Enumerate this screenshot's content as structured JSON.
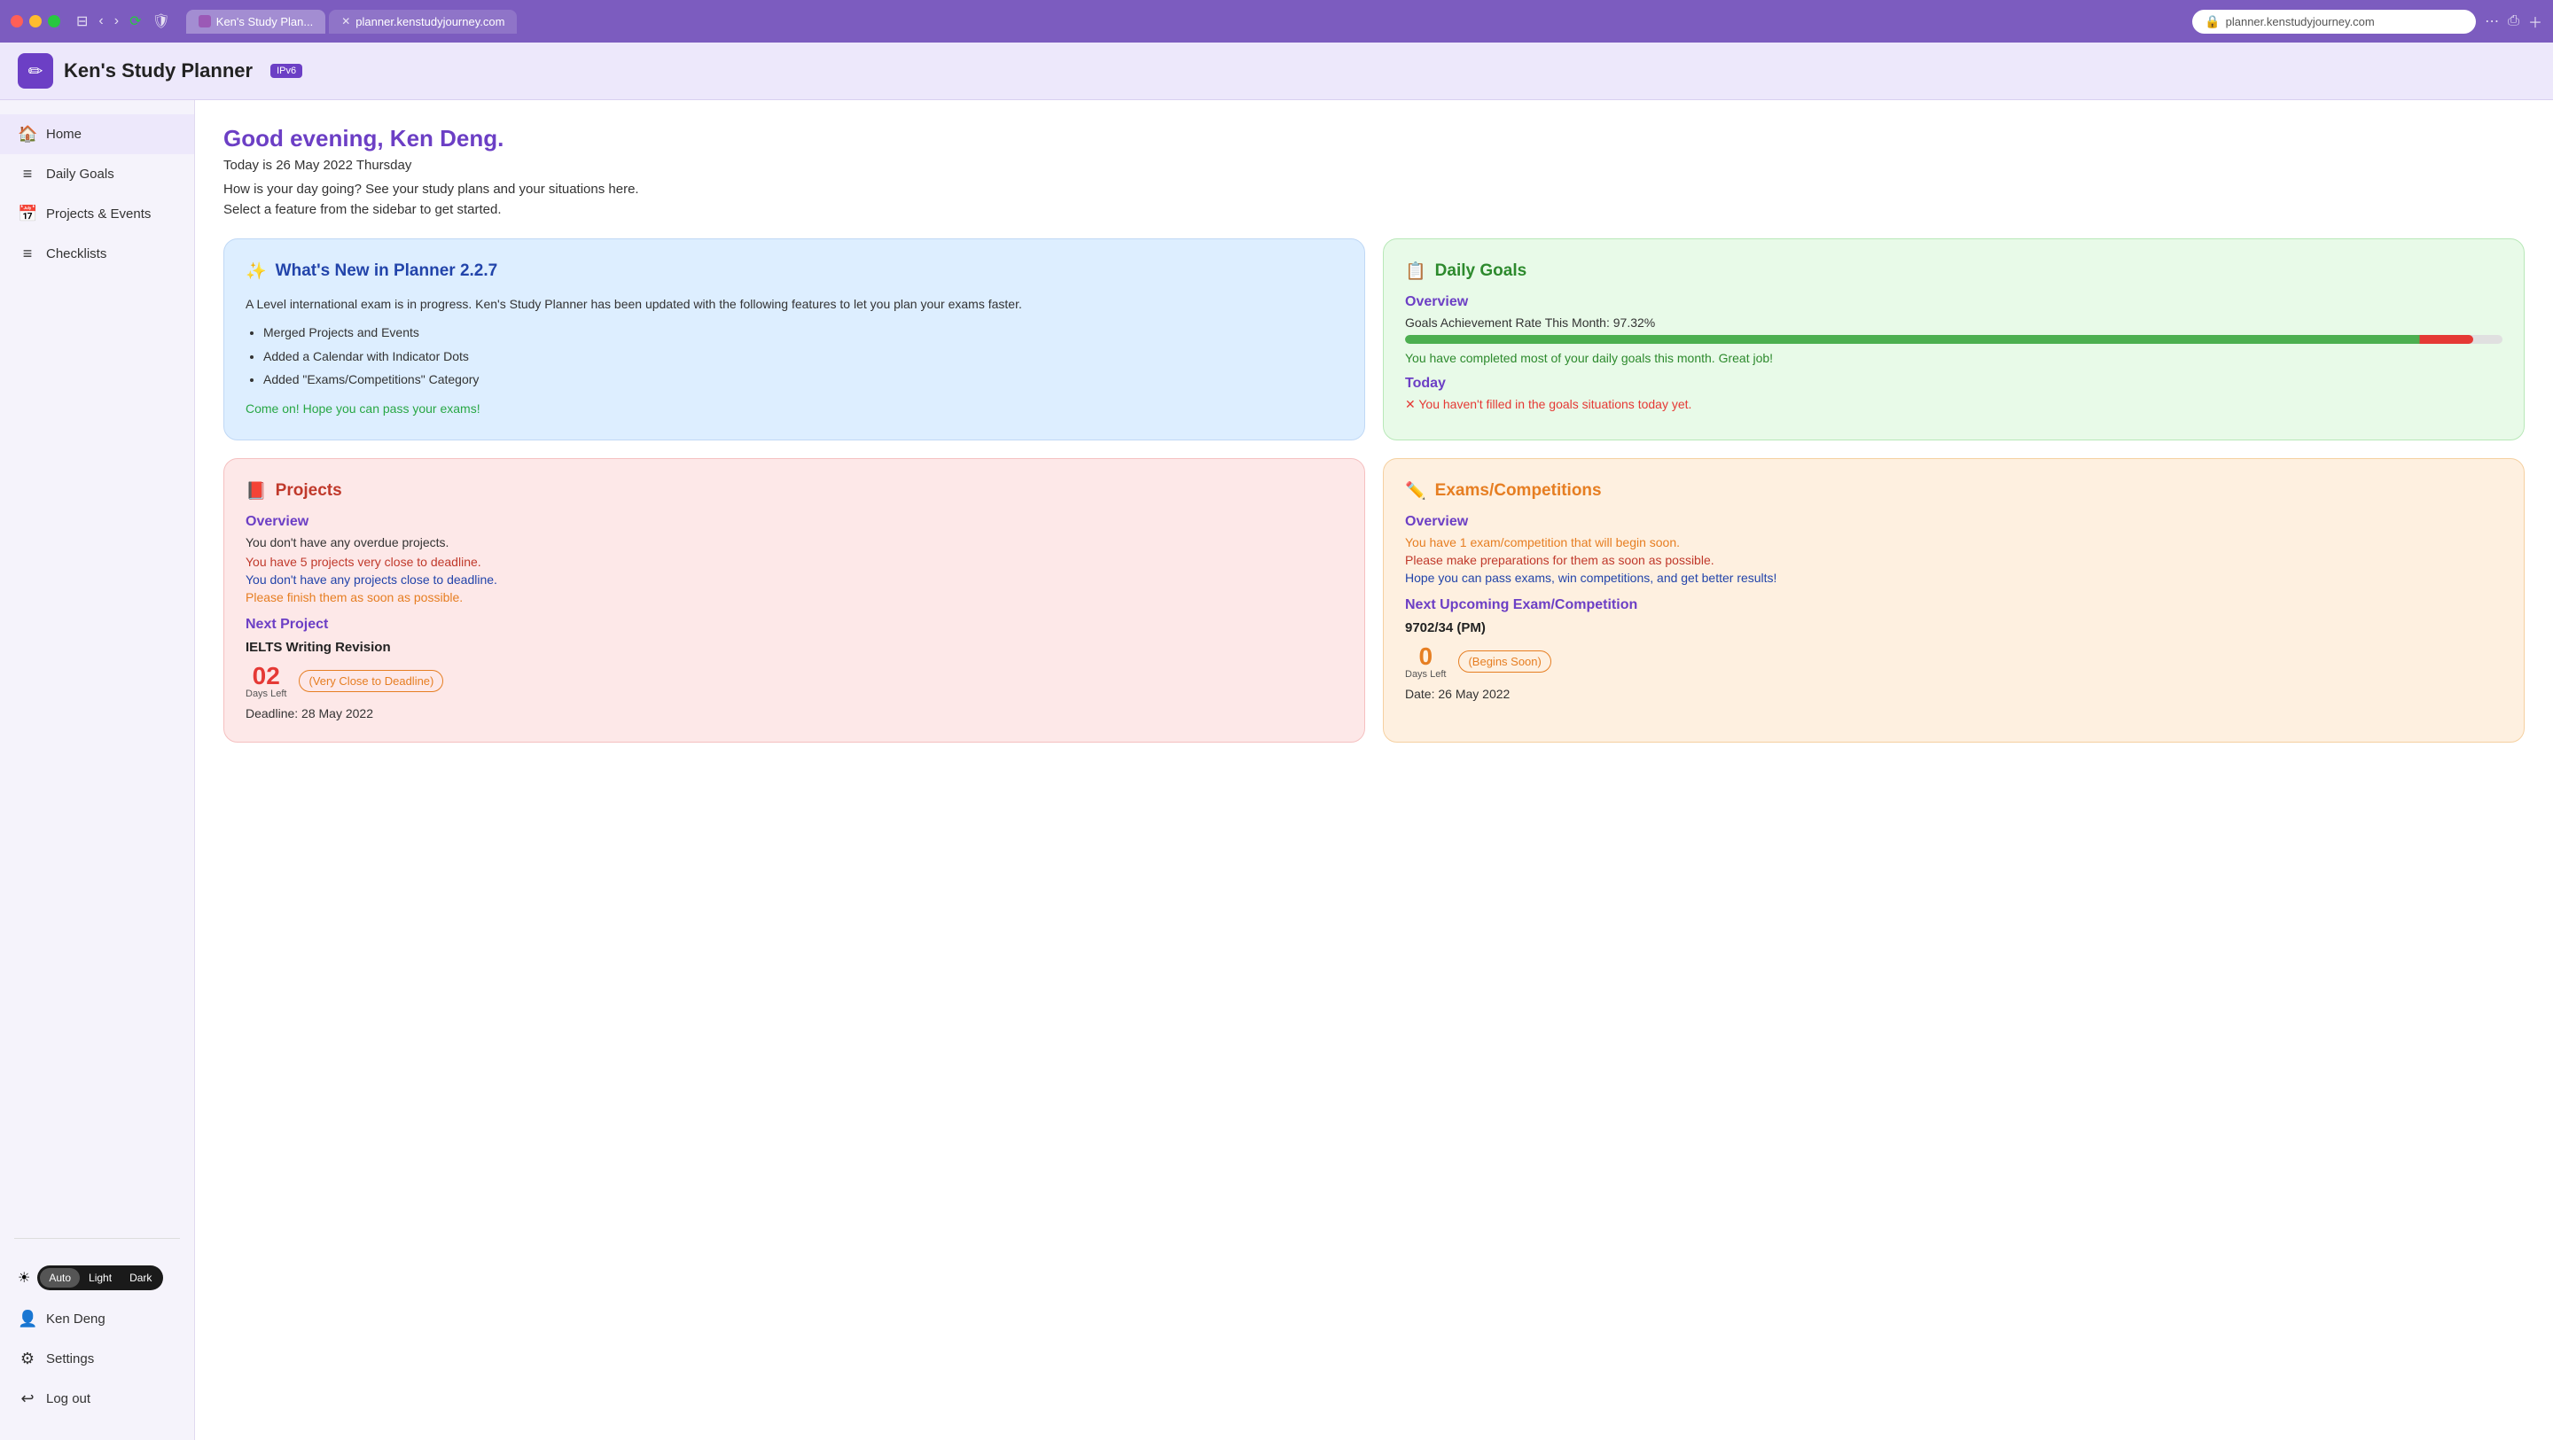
{
  "browser": {
    "tab1_label": "Ken's Study Plan...",
    "tab2_label": "planner.kenstudyjourney.com",
    "address": "planner.kenstudyjourney.com"
  },
  "header": {
    "app_title": "Ken's Study Planner",
    "ipv6_badge": "IPv6"
  },
  "sidebar": {
    "items": [
      {
        "id": "home",
        "icon": "🏠",
        "label": "Home"
      },
      {
        "id": "daily-goals",
        "icon": "📋",
        "label": "Daily Goals"
      },
      {
        "id": "projects-events",
        "icon": "📅",
        "label": "Projects & Events"
      },
      {
        "id": "checklists",
        "icon": "📝",
        "label": "Checklists"
      }
    ],
    "theme_options": [
      "Auto",
      "Light",
      "Dark"
    ],
    "selected_theme": "Auto",
    "user_name": "Ken Deng",
    "settings_label": "Settings",
    "logout_label": "Log out"
  },
  "main": {
    "greeting": "Good evening, Ken Deng.",
    "date": "Today is 26 May 2022 Thursday",
    "tagline": "How is your day going? See your study plans and your situations here.",
    "select_feature": "Select a feature from the sidebar to get started."
  },
  "whats_new": {
    "title": "What's New in Planner 2.2.7",
    "icon": "✨",
    "body_text": "A Level international exam is in progress. Ken's Study Planner has been updated with the following features to let you plan your exams faster.",
    "features": [
      "Merged Projects and Events",
      "Added a Calendar with Indicator Dots",
      "Added \"Exams/Competitions\" Category"
    ],
    "cta": "Come on! Hope you can pass your exams!"
  },
  "daily_goals": {
    "title": "Daily Goals",
    "icon": "📋",
    "overview_title": "Overview",
    "achievement_label": "Goals Achievement Rate This Month: 97.32%",
    "progress_percent": 97.32,
    "comment": "You have completed most of your daily goals this month. Great job!",
    "today_title": "Today",
    "today_warning": "✕ You haven't filled in the goals situations today yet."
  },
  "projects": {
    "title": "Projects",
    "icon": "📕",
    "overview_title": "Overview",
    "no_overdue": "You don't have any overdue projects.",
    "warning_close": "You have 5 projects very close to deadline.",
    "no_close": "You don't have any projects close to deadline.",
    "finish_soon": "Please finish them as soon as possible.",
    "next_project_title": "Next Project",
    "project_name": "IELTS Writing Revision",
    "days_left_number": "02",
    "days_left_label": "Days Left",
    "deadline_badge": "(Very Close to Deadline)",
    "deadline_date": "Deadline: 28 May 2022"
  },
  "exams": {
    "title": "Exams/Competitions",
    "icon": "✏️",
    "overview_title": "Overview",
    "exam_soon": "You have 1 exam/competition that will begin soon.",
    "prepare": "Please make preparations for them as soon as possible.",
    "hope": "Hope you can pass exams, win competitions, and get better results!",
    "next_title": "Next Upcoming Exam/Competition",
    "exam_name": "9702/34 (PM)",
    "days_left_number": "0",
    "days_left_label": "Days Left",
    "begins_badge": "(Begins Soon)",
    "exam_date": "Date: 26 May 2022"
  }
}
